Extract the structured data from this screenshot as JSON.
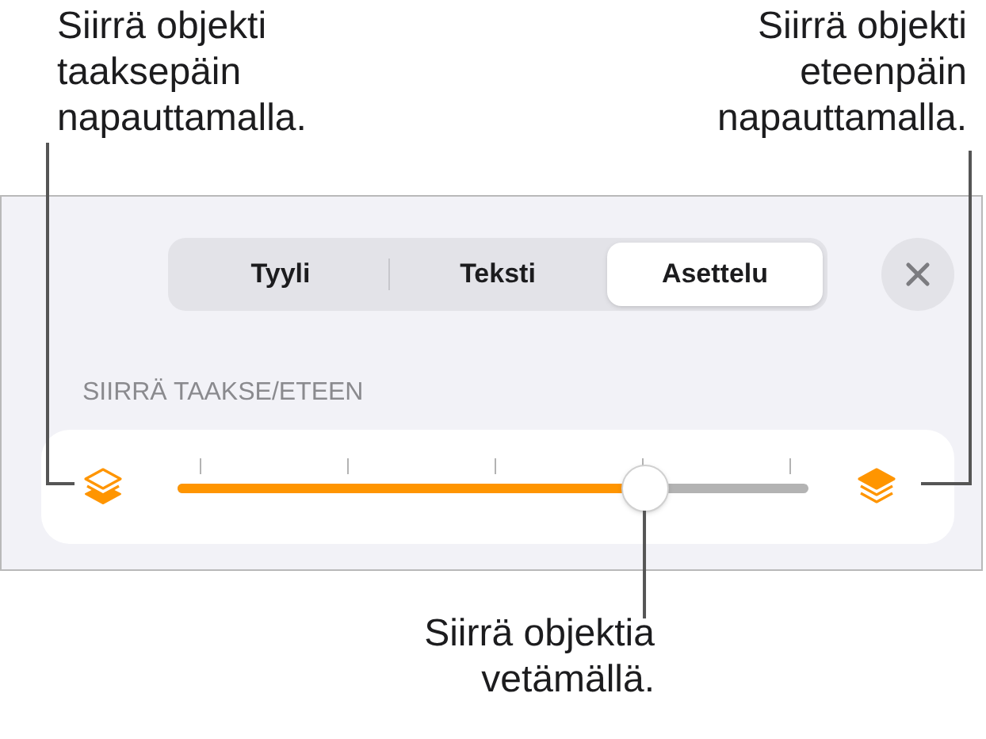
{
  "top_left_callout": {
    "lines": [
      "Siirrä objekti",
      "taaksepäin",
      "napauttamalla."
    ]
  },
  "top_right_callout": {
    "lines": [
      "Siirrä objekti",
      "eteenpäin",
      "napauttamalla."
    ]
  },
  "tabs": [
    {
      "label": "Tyyli",
      "selected": false
    },
    {
      "label": "Teksti",
      "selected": false
    },
    {
      "label": "Asettelu",
      "selected": true
    }
  ],
  "section_label": "SIIRRÄ TAAKSE/ETEEN",
  "slider": {
    "level": 0.74
  },
  "bottom_callout": {
    "lines": [
      "Siirrä objektia",
      "vetämällä."
    ]
  }
}
